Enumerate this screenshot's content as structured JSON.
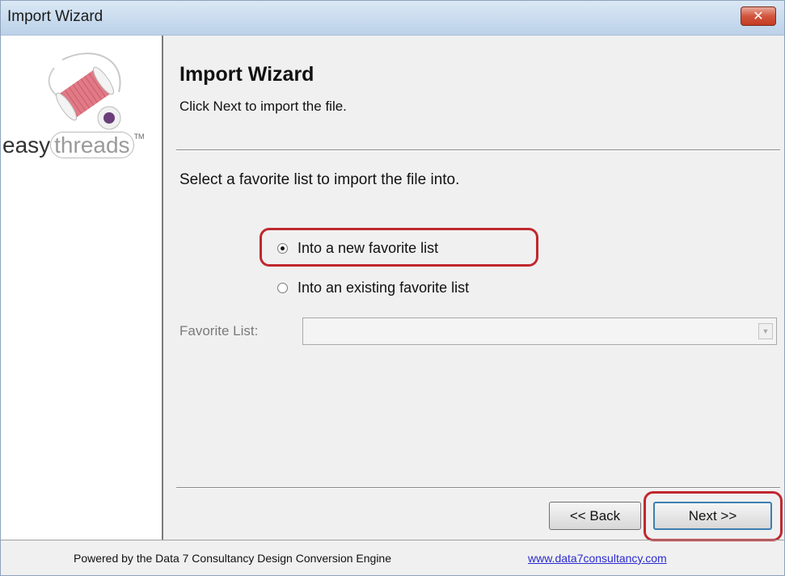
{
  "window": {
    "title": "Import Wizard",
    "close_icon": "close-icon"
  },
  "sidebar": {
    "logo_icon": "spool-thread-icon",
    "logo_word_1": "easy",
    "logo_word_2": "threads",
    "logo_tm": "TM"
  },
  "content": {
    "title": "Import Wizard",
    "subtitle": "Click Next to import the file.",
    "instruction": "Select a favorite list to import the file into."
  },
  "options": [
    {
      "label": "Into a new favorite list",
      "checked": true
    },
    {
      "label": "Into an existing favorite list",
      "checked": false
    }
  ],
  "favorite_list": {
    "label": "Favorite List:",
    "value": "",
    "enabled": false
  },
  "buttons": {
    "back": "<< Back",
    "next": "Next >>"
  },
  "footer": {
    "text": "Powered by the Data 7 Consultancy Design Conversion Engine",
    "link": "www.data7consultancy.com"
  },
  "colors": {
    "highlight": "#c0282f",
    "default_button_border": "#3c7fb1"
  }
}
